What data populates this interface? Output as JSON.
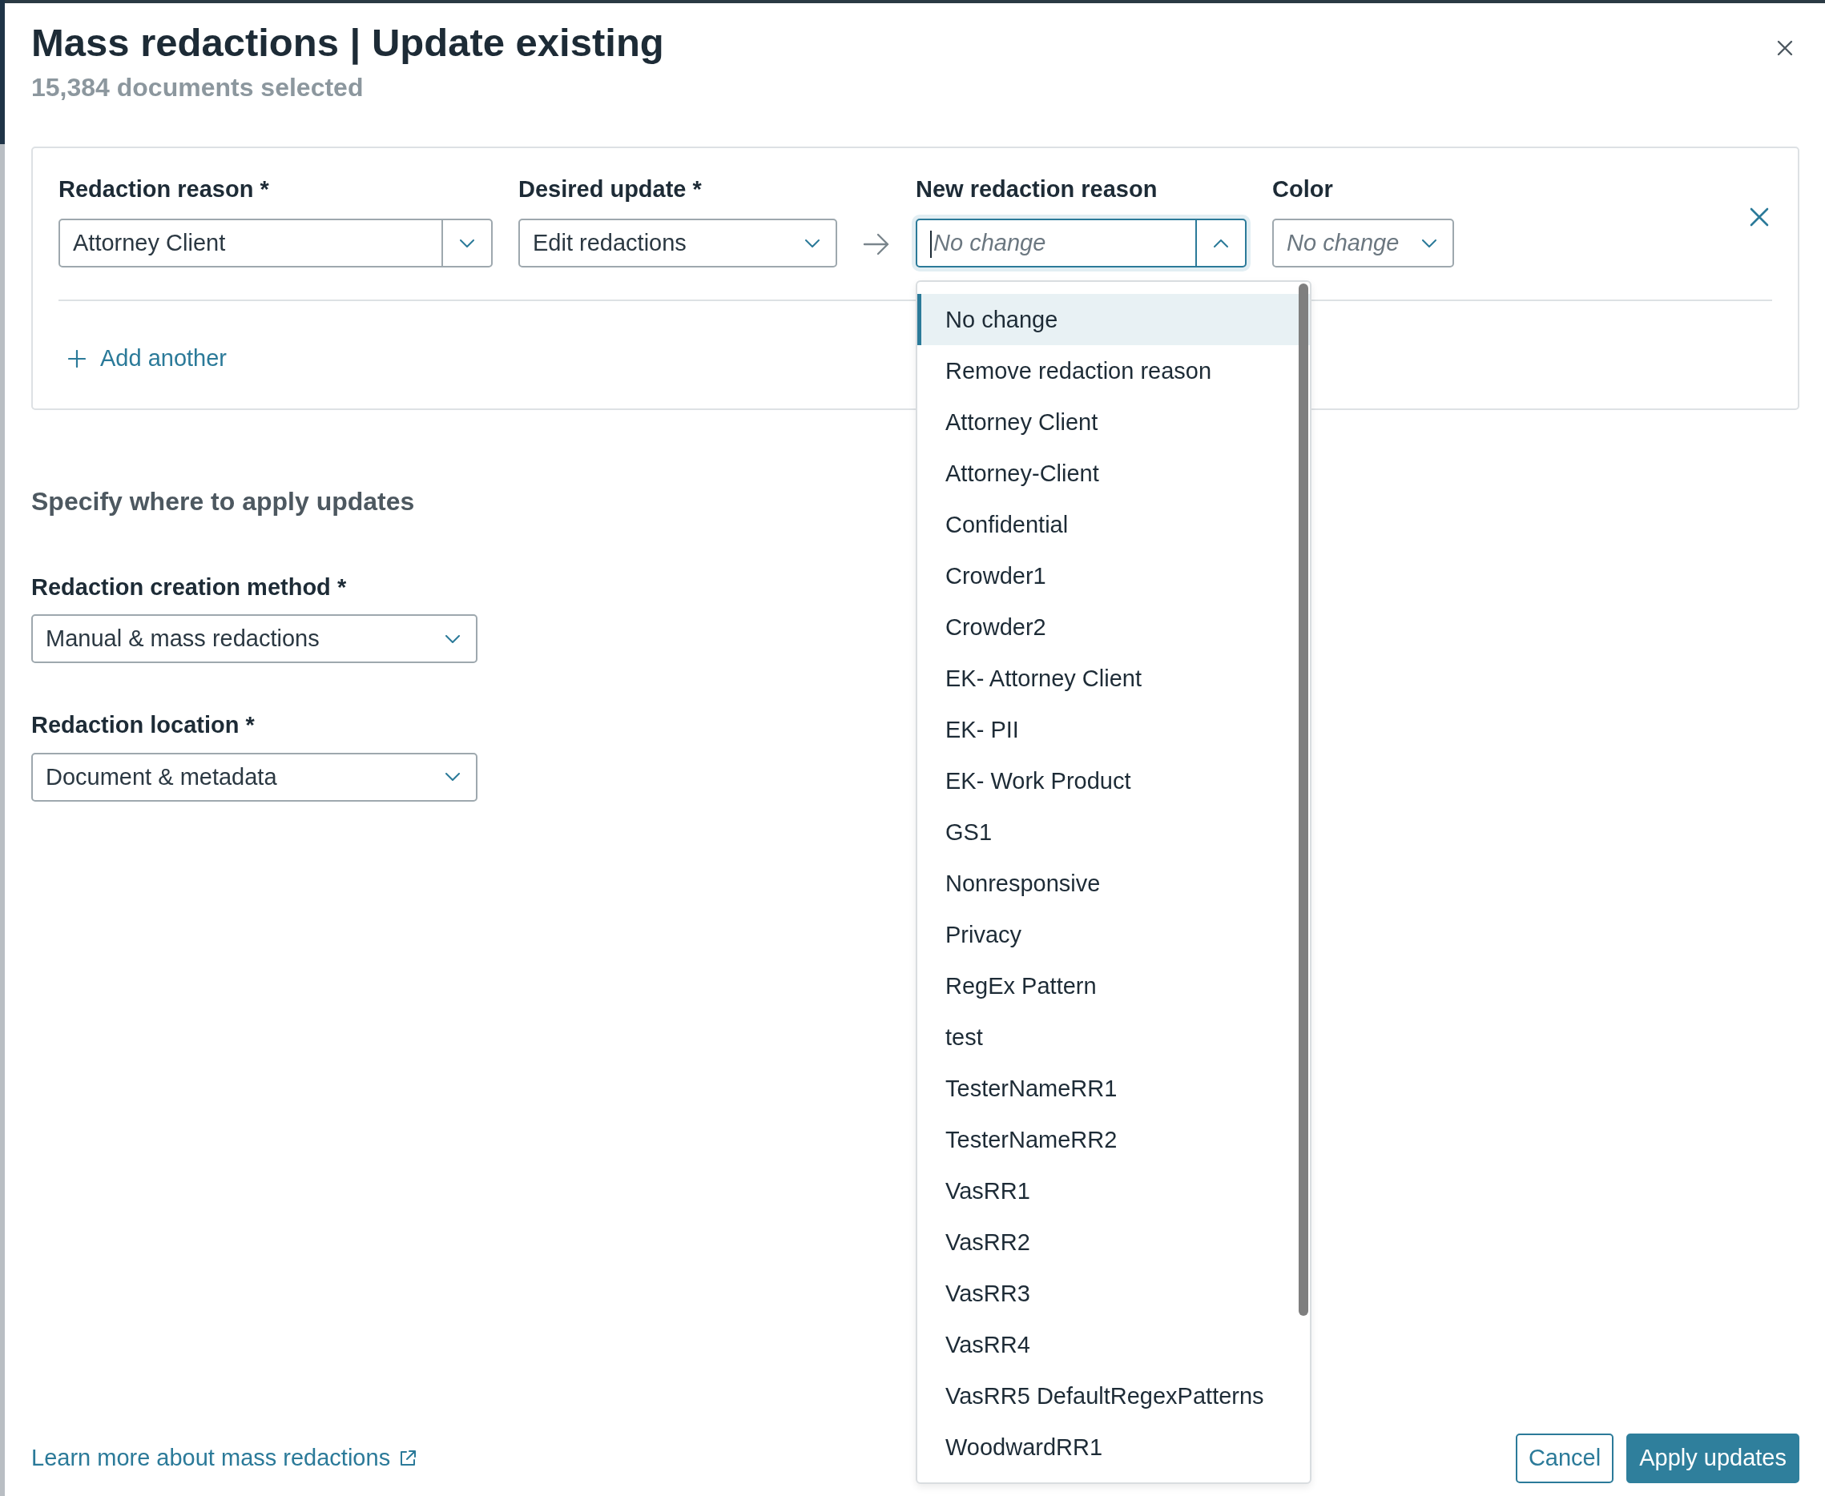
{
  "dialog": {
    "title": "Mass redactions | Update existing",
    "subtitle": "15,384 documents selected"
  },
  "rule": {
    "fields": [
      {
        "kind": "select",
        "label": "Redaction reason *",
        "value": "Attorney Client",
        "split_toggle": true
      },
      {
        "kind": "select",
        "label": "Desired update *",
        "value": "Edit redactions"
      },
      {
        "kind": "arrow"
      },
      {
        "kind": "combobox",
        "label": "New redaction reason",
        "placeholder": "No change",
        "expanded": true
      },
      {
        "kind": "select",
        "label": "Color",
        "placeholder": "No change"
      }
    ],
    "add_another": "Add another"
  },
  "dropdown_options": [
    {
      "label": "No change",
      "selected": true
    },
    {
      "label": "Remove redaction reason",
      "selected": false
    },
    {
      "label": "Attorney Client",
      "selected": false
    },
    {
      "label": "Attorney-Client",
      "selected": false
    },
    {
      "label": "Confidential",
      "selected": false
    },
    {
      "label": "Crowder1",
      "selected": false
    },
    {
      "label": "Crowder2",
      "selected": false
    },
    {
      "label": "EK- Attorney Client",
      "selected": false
    },
    {
      "label": "EK- PII",
      "selected": false
    },
    {
      "label": "EK- Work Product",
      "selected": false
    },
    {
      "label": "GS1",
      "selected": false
    },
    {
      "label": "Nonresponsive",
      "selected": false
    },
    {
      "label": "Privacy",
      "selected": false
    },
    {
      "label": "RegEx Pattern",
      "selected": false
    },
    {
      "label": "test",
      "selected": false
    },
    {
      "label": "TesterNameRR1",
      "selected": false
    },
    {
      "label": "TesterNameRR2",
      "selected": false
    },
    {
      "label": "VasRR1",
      "selected": false
    },
    {
      "label": "VasRR2",
      "selected": false
    },
    {
      "label": "VasRR3",
      "selected": false
    },
    {
      "label": "VasRR4",
      "selected": false
    },
    {
      "label": "VasRR5 DefaultRegexPatterns",
      "selected": false
    },
    {
      "label": "WoodwardRR1",
      "selected": false
    }
  ],
  "apply_section": {
    "heading": "Specify where to apply updates",
    "fields": [
      {
        "label": "Redaction creation method *",
        "value": "Manual & mass redactions"
      },
      {
        "label": "Redaction location *",
        "value": "Document & metadata"
      }
    ]
  },
  "footer": {
    "link": "Learn more about mass redactions",
    "buttons": [
      {
        "label": "Cancel",
        "kind": "secondary"
      },
      {
        "label": "Apply updates",
        "kind": "primary"
      }
    ]
  }
}
